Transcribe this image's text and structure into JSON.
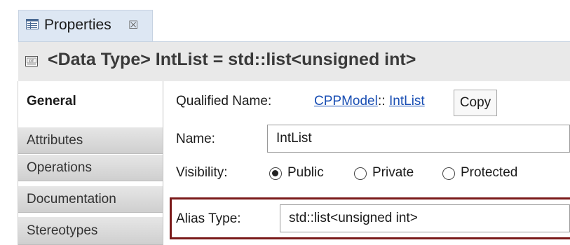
{
  "tab": {
    "label": "Properties",
    "close_glyph": "☒"
  },
  "title": {
    "text": "<Data Type> IntList = std::list<unsigned int>"
  },
  "sections": [
    {
      "label": "General",
      "active": true
    },
    {
      "label": "Attributes",
      "active": false
    },
    {
      "label": "Operations",
      "active": false
    },
    {
      "label": "Documentation",
      "active": false
    },
    {
      "label": "Stereotypes",
      "active": false
    }
  ],
  "general": {
    "qualified_name_label": "Qualified Name:",
    "qualified_name_part1": "CPPModel",
    "qualified_name_sep": "::",
    "qualified_name_part2": "IntList",
    "copy_label": "Copy",
    "name_label": "Name:",
    "name_value": "IntList",
    "visibility_label": "Visibility:",
    "visibility_options": [
      "Public",
      "Private",
      "Protected"
    ],
    "visibility_selected": "Public",
    "alias_type_label": "Alias Type:",
    "alias_type_value": "std::list<unsigned int>"
  },
  "colors": {
    "highlight_border": "#7a1a1a",
    "link": "#1a4fb4"
  }
}
